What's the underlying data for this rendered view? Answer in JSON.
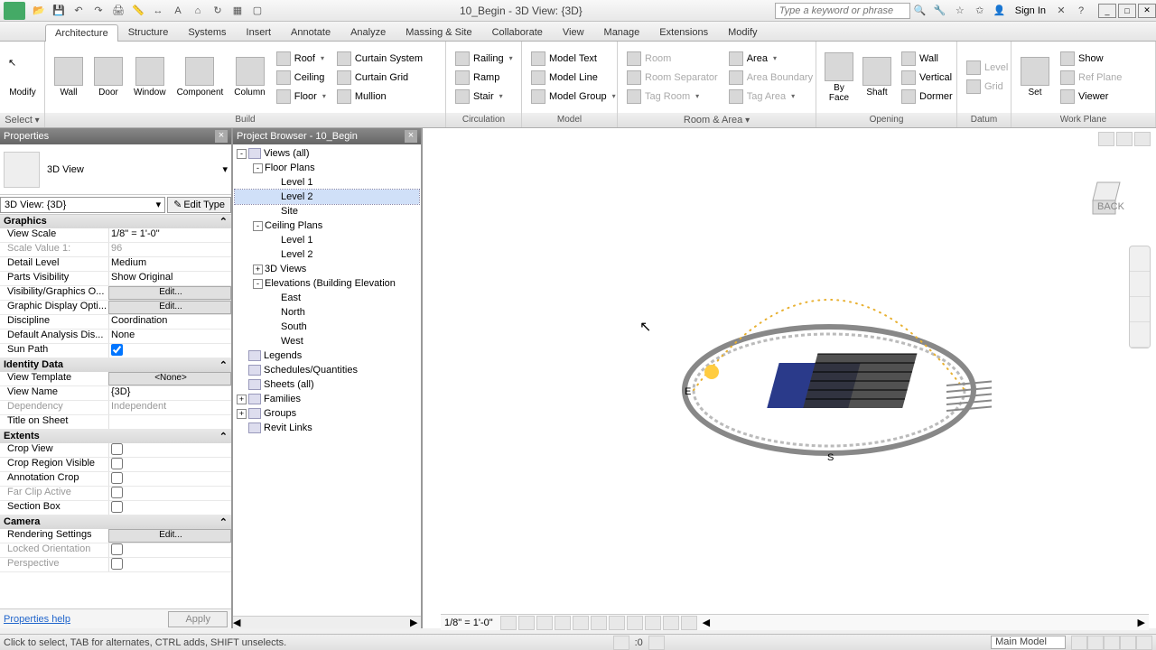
{
  "titlebar": {
    "title": "10_Begin - 3D View: {3D}",
    "search_placeholder": "Type a keyword or phrase",
    "signin": "Sign In"
  },
  "tabs": [
    "Architecture",
    "Structure",
    "Systems",
    "Insert",
    "Annotate",
    "Analyze",
    "Massing & Site",
    "Collaborate",
    "View",
    "Manage",
    "Extensions",
    "Modify"
  ],
  "active_tab": "Architecture",
  "ribbon": {
    "select": {
      "modify": "Modify",
      "title": "Select"
    },
    "build": {
      "wall": "Wall",
      "door": "Door",
      "window": "Window",
      "component": "Component",
      "column": "Column",
      "roof": "Roof",
      "ceiling": "Ceiling",
      "floor": "Floor",
      "curtain_system": "Curtain System",
      "curtain_grid": "Curtain Grid",
      "mullion": "Mullion",
      "title": "Build"
    },
    "circulation": {
      "railing": "Railing",
      "ramp": "Ramp",
      "stair": "Stair",
      "title": "Circulation"
    },
    "model": {
      "model_text": "Model Text",
      "model_line": "Model Line",
      "model_group": "Model Group",
      "title": "Model"
    },
    "room_area": {
      "room": "Room",
      "room_sep": "Room Separator",
      "tag_room": "Tag Room",
      "area": "Area",
      "area_bound": "Area Boundary",
      "tag_area": "Tag Area",
      "title": "Room & Area"
    },
    "opening": {
      "by_face": "By\nFace",
      "shaft": "Shaft",
      "wall": "Wall",
      "vertical": "Vertical",
      "dormer": "Dormer",
      "title": "Opening"
    },
    "datum": {
      "level": "Level",
      "grid": "Grid",
      "title": "Datum"
    },
    "work_plane": {
      "set": "Set",
      "show": "Show",
      "ref_plane": "Ref Plane",
      "viewer": "Viewer",
      "title": "Work Plane"
    }
  },
  "properties": {
    "title": "Properties",
    "type": "3D View",
    "instance": "3D View: {3D}",
    "edit_type": "Edit Type",
    "groups": [
      {
        "name": "Graphics",
        "rows": [
          {
            "k": "View Scale",
            "v": "1/8\" = 1'-0\""
          },
          {
            "k": "Scale Value    1:",
            "v": "96",
            "gray": true
          },
          {
            "k": "Detail Level",
            "v": "Medium"
          },
          {
            "k": "Parts Visibility",
            "v": "Show Original"
          },
          {
            "k": "Visibility/Graphics O...",
            "v": "Edit...",
            "btn": true
          },
          {
            "k": "Graphic Display Opti...",
            "v": "Edit...",
            "btn": true
          },
          {
            "k": "Discipline",
            "v": "Coordination"
          },
          {
            "k": "Default Analysis Dis...",
            "v": "None"
          },
          {
            "k": "Sun Path",
            "v": "",
            "check": true,
            "checked": true
          }
        ]
      },
      {
        "name": "Identity Data",
        "rows": [
          {
            "k": "View Template",
            "v": "<None>",
            "btn": true
          },
          {
            "k": "View Name",
            "v": "{3D}"
          },
          {
            "k": "Dependency",
            "v": "Independent",
            "gray": true
          },
          {
            "k": "Title on Sheet",
            "v": ""
          }
        ]
      },
      {
        "name": "Extents",
        "rows": [
          {
            "k": "Crop View",
            "v": "",
            "check": true
          },
          {
            "k": "Crop Region Visible",
            "v": "",
            "check": true
          },
          {
            "k": "Annotation Crop",
            "v": "",
            "check": true
          },
          {
            "k": "Far Clip Active",
            "v": "",
            "check": true,
            "gray": true
          },
          {
            "k": "Section Box",
            "v": "",
            "check": true
          }
        ]
      },
      {
        "name": "Camera",
        "rows": [
          {
            "k": "Rendering Settings",
            "v": "Edit...",
            "btn": true
          },
          {
            "k": "Locked Orientation",
            "v": "",
            "check": true,
            "gray": true
          },
          {
            "k": "Perspective",
            "v": "",
            "check": true,
            "gray": true
          }
        ]
      }
    ],
    "help": "Properties help",
    "apply": "Apply"
  },
  "browser": {
    "title": "Project Browser - 10_Begin",
    "tree": [
      {
        "d": 0,
        "exp": "-",
        "label": "Views (all)",
        "icon": true
      },
      {
        "d": 1,
        "exp": "-",
        "label": "Floor Plans"
      },
      {
        "d": 2,
        "label": "Level 1"
      },
      {
        "d": 2,
        "label": "Level 2",
        "sel": true
      },
      {
        "d": 2,
        "label": "Site"
      },
      {
        "d": 1,
        "exp": "-",
        "label": "Ceiling Plans"
      },
      {
        "d": 2,
        "label": "Level 1"
      },
      {
        "d": 2,
        "label": "Level 2"
      },
      {
        "d": 1,
        "exp": "+",
        "label": "3D Views"
      },
      {
        "d": 1,
        "exp": "-",
        "label": "Elevations (Building Elevation"
      },
      {
        "d": 2,
        "label": "East"
      },
      {
        "d": 2,
        "label": "North"
      },
      {
        "d": 2,
        "label": "South"
      },
      {
        "d": 2,
        "label": "West"
      },
      {
        "d": 0,
        "label": "Legends",
        "icon": true
      },
      {
        "d": 0,
        "label": "Schedules/Quantities",
        "icon": true
      },
      {
        "d": 0,
        "label": "Sheets (all)",
        "icon": true
      },
      {
        "d": 0,
        "exp": "+",
        "label": "Families",
        "icon": true
      },
      {
        "d": 0,
        "exp": "+",
        "label": "Groups",
        "icon": true
      },
      {
        "d": 0,
        "label": "Revit Links",
        "icon": true
      }
    ]
  },
  "viewbar": {
    "scale": "1/8\" = 1'-0\""
  },
  "status": {
    "hint": "Click to select, TAB for alternates, CTRL adds, SHIFT unselects.",
    "filter_count": ":0",
    "workset": "Main Model"
  }
}
